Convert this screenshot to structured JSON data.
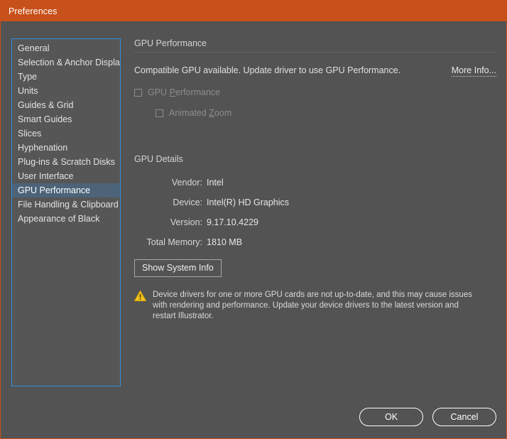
{
  "window": {
    "title": "Preferences",
    "titlebar_color": "#c8501a",
    "background_color": "#535353"
  },
  "sidebar": {
    "selected": "GPU Performance",
    "focus_border_color": "#2b8fe0",
    "selection_color": "#4c6378",
    "items": [
      {
        "label": "General"
      },
      {
        "label": "Selection & Anchor Display"
      },
      {
        "label": "Type"
      },
      {
        "label": "Units"
      },
      {
        "label": "Guides & Grid"
      },
      {
        "label": "Smart Guides"
      },
      {
        "label": "Slices"
      },
      {
        "label": "Hyphenation"
      },
      {
        "label": "Plug-ins & Scratch Disks"
      },
      {
        "label": "User Interface"
      },
      {
        "label": "GPU Performance"
      },
      {
        "label": "File Handling & Clipboard"
      },
      {
        "label": "Appearance of Black"
      }
    ]
  },
  "main": {
    "performance_section": {
      "heading": "GPU Performance",
      "status_text": "Compatible GPU available. Update driver to use GPU Performance.",
      "more_info_label": "More Info...",
      "checkboxes": [
        {
          "label_before": "GPU ",
          "accel": "P",
          "label_after": "erformance",
          "checked": false,
          "disabled": true
        },
        {
          "label_before": "Animated ",
          "accel": "Z",
          "label_after": "oom",
          "checked": false,
          "disabled": true
        }
      ]
    },
    "details_section": {
      "heading": "GPU Details",
      "rows": [
        {
          "label": "Vendor:",
          "value": "Intel"
        },
        {
          "label": "Device:",
          "value": "Intel(R) HD Graphics"
        },
        {
          "label": "Version:",
          "value": "9.17.10.4229"
        },
        {
          "label": "Total Memory:",
          "value": "1810 MB"
        }
      ],
      "system_info_button": "Show System Info"
    },
    "warning": {
      "icon": "warning-triangle-icon",
      "icon_color": "#f0c020",
      "text": "Device drivers for one or more GPU cards are not up-to-date, and this may cause issues with rendering and performance. Update your device drivers to the latest version and restart Illustrator."
    }
  },
  "footer": {
    "ok_label": "OK",
    "cancel_label": "Cancel"
  }
}
